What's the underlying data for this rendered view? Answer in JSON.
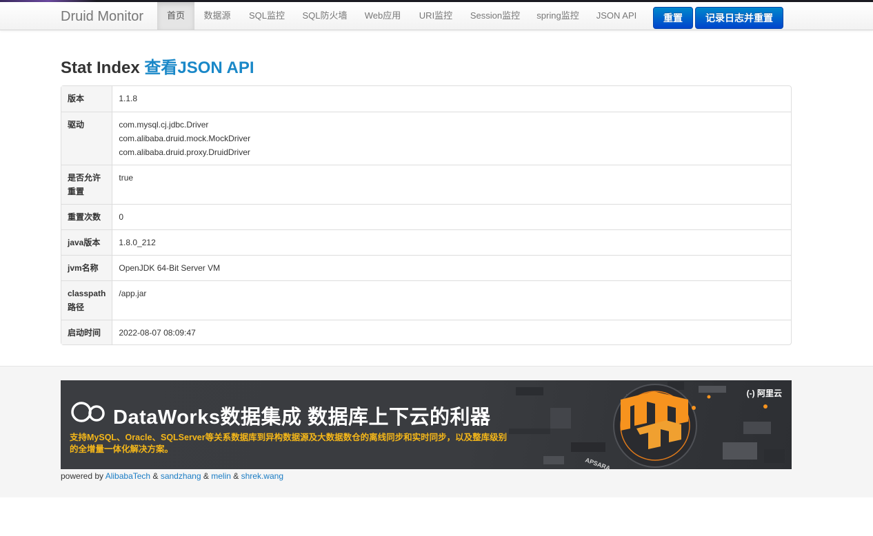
{
  "navbar": {
    "brand": "Druid Monitor",
    "items": [
      {
        "label": "首页",
        "active": true
      },
      {
        "label": "数据源"
      },
      {
        "label": "SQL监控"
      },
      {
        "label": "SQL防火墙"
      },
      {
        "label": "Web应用"
      },
      {
        "label": "URI监控"
      },
      {
        "label": "Session监控"
      },
      {
        "label": "spring监控"
      },
      {
        "label": "JSON API"
      }
    ],
    "reset_button": "重置",
    "log_reset_button": "记录日志并重置"
  },
  "page": {
    "title_prefix": "Stat Index",
    "title_link": "查看JSON API"
  },
  "stats": {
    "rows": [
      {
        "label": "版本",
        "values": [
          "1.1.8"
        ]
      },
      {
        "label": "驱动",
        "values": [
          "com.mysql.cj.jdbc.Driver",
          "com.alibaba.druid.mock.MockDriver",
          "com.alibaba.druid.proxy.DruidDriver"
        ]
      },
      {
        "label_lines": [
          "是否允许",
          "重置"
        ],
        "values": [
          "true"
        ]
      },
      {
        "label": "重置次数",
        "values": [
          "0"
        ]
      },
      {
        "label": "java版本",
        "values": [
          "1.8.0_212"
        ]
      },
      {
        "label": "jvm名称",
        "values": [
          "OpenJDK 64-Bit Server VM"
        ]
      },
      {
        "label_lines": [
          "classpath",
          "路径"
        ],
        "values": [
          "/app.jar"
        ]
      },
      {
        "label": "启动时间",
        "values": [
          "2022-08-07 08:09:47"
        ]
      }
    ]
  },
  "banner": {
    "headline": "DataWorks数据集成 数据库上下云的利器",
    "subtext": "支持MySQL、Oracle、SQLServer等关系数据库到异构数据源及大数据数仓的离线同步和实时同步，以及整库级别的全增量一体化解决方案。",
    "vendor_logo": "阿里云",
    "vendor_logo_mark": "(-)",
    "art_label": "APSARA",
    "colors": {
      "accent": "#f5b719",
      "background": "#3a3c40"
    }
  },
  "footer": {
    "powered_by": "powered by",
    "amp": "&",
    "authors": [
      "AlibabaTech",
      "sandzhang",
      "melin",
      "shrek.wang"
    ]
  },
  "colors": {
    "link": "#1a88c8",
    "button": "#0066cc",
    "nav_active_bg": "#e5e5e5"
  }
}
